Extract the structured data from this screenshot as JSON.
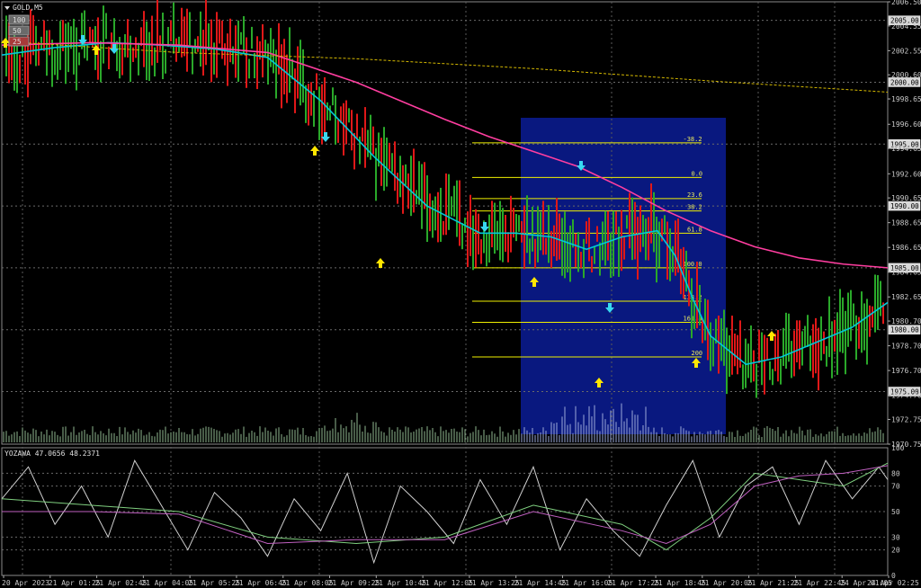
{
  "chart_data": {
    "type": "line",
    "symbol": "GOLD,M5",
    "oscillator_label": "YOZAWA 47.0656 48.2371",
    "buttons": [
      "100",
      "50",
      "25"
    ],
    "y_price_ticks": [
      "2006.50",
      "2004.55",
      "2002.55",
      "2000.60",
      "1998.65",
      "1996.60",
      "1994.65",
      "1992.60",
      "1990.65",
      "1988.65",
      "1986.65",
      "1984.65",
      "1982.65",
      "1980.70",
      "1978.70",
      "1976.70",
      "1974.70",
      "1972.75",
      "1970.75"
    ],
    "y_level_boxes": [
      "2005.00",
      "2000.00",
      "1995.00",
      "1990.00",
      "1985.00",
      "1980.00",
      "1975.00"
    ],
    "y_osc_ticks": [
      "100",
      "80",
      "70",
      "50",
      "30",
      "20",
      "0"
    ],
    "x_ticks": [
      "20 Apr 2023",
      "21 Apr 01:25",
      "21 Apr 02:45",
      "21 Apr 04:05",
      "21 Apr 05:25",
      "21 Apr 06:45",
      "21 Apr 08:05",
      "21 Apr 09:25",
      "21 Apr 10:45",
      "21 Apr 12:05",
      "21 Apr 13:25",
      "21 Apr 14:45",
      "21 Apr 16:05",
      "21 Apr 17:25",
      "21 Apr 18:45",
      "21 Apr 20:05",
      "21 Apr 21:25",
      "21 Apr 22:45",
      "24 Apr 01:05",
      "24 Apr 02:25"
    ],
    "fib_levels": [
      {
        "label": "-38.2",
        "price": 1995.1
      },
      {
        "label": "0.0",
        "price": 1992.3
      },
      {
        "label": "23.6",
        "price": 1990.6
      },
      {
        "label": "38.2",
        "price": 1989.6
      },
      {
        "label": "61.8",
        "price": 1987.8
      },
      {
        "label": "100.0",
        "price": 1985.0
      },
      {
        "label": "138.2",
        "price": 1982.3
      },
      {
        "label": "161.8",
        "price": 1980.6
      },
      {
        "label": "200",
        "price": 1977.8
      }
    ],
    "ylim": [
      1970.75,
      2006.5
    ],
    "series": [
      {
        "name": "",
        "color": "#00c8d8",
        "x": [
          0,
          6,
          12,
          18,
          24,
          30,
          36,
          42,
          48,
          54,
          58,
          62,
          66,
          70,
          74,
          76,
          78,
          80,
          84,
          88,
          92,
          96,
          100
        ],
        "y": [
          2002.2,
          2002.8,
          2003.2,
          2003.0,
          2002.7,
          2002.0,
          1998.5,
          1994.0,
          1990.0,
          1987.8,
          1987.8,
          1987.5,
          1986.5,
          1987.5,
          1988.0,
          1986.0,
          1982.5,
          1979.5,
          1977.2,
          1977.8,
          1979.0,
          1980.2,
          1982.2
        ]
      },
      {
        "name": "",
        "color": "#ff3ea0",
        "x": [
          0,
          10,
          20,
          30,
          40,
          50,
          55,
          60,
          65,
          70,
          75,
          80,
          85,
          90,
          95,
          100
        ],
        "y": [
          2003.0,
          2003.2,
          2003.0,
          2002.4,
          2000.0,
          1997.0,
          1995.6,
          1994.4,
          1993.2,
          1991.5,
          1989.6,
          1988.0,
          1986.7,
          1985.8,
          1985.3,
          1985.0
        ]
      },
      {
        "name": "",
        "color": "#d4b800",
        "x": [
          0,
          20,
          40,
          60,
          80,
          100
        ],
        "y": [
          2003.3,
          2002.4,
          2001.9,
          2001.1,
          2000.1,
          1999.2
        ]
      }
    ],
    "oscillator": {
      "ylim": [
        0,
        100
      ],
      "series": [
        {
          "name": "",
          "color": "#cfcfcf",
          "x": [
            0,
            3,
            6,
            9,
            12,
            15,
            18,
            21,
            24,
            27,
            30,
            33,
            36,
            39,
            42,
            45,
            48,
            51,
            54,
            57,
            60,
            63,
            66,
            69,
            72,
            75,
            78,
            81,
            84,
            87,
            90,
            93,
            96,
            99,
            100
          ],
          "y": [
            60,
            85,
            40,
            70,
            30,
            90,
            55,
            20,
            65,
            45,
            15,
            60,
            35,
            80,
            10,
            70,
            50,
            25,
            75,
            40,
            85,
            20,
            60,
            35,
            15,
            55,
            90,
            30,
            70,
            85,
            40,
            90,
            60,
            85,
            75
          ]
        },
        {
          "name": "",
          "color": "#7fcf7f",
          "x": [
            0,
            10,
            20,
            30,
            40,
            50,
            60,
            70,
            75,
            80,
            85,
            90,
            95,
            100
          ],
          "y": [
            60,
            55,
            50,
            30,
            25,
            30,
            55,
            40,
            20,
            45,
            80,
            75,
            70,
            88
          ]
        },
        {
          "name": "",
          "color": "#c060c0",
          "x": [
            0,
            10,
            20,
            30,
            40,
            50,
            60,
            70,
            75,
            80,
            85,
            90,
            95,
            100
          ],
          "y": [
            50,
            50,
            48,
            25,
            28,
            28,
            50,
            35,
            25,
            40,
            70,
            78,
            80,
            86
          ]
        }
      ]
    }
  }
}
